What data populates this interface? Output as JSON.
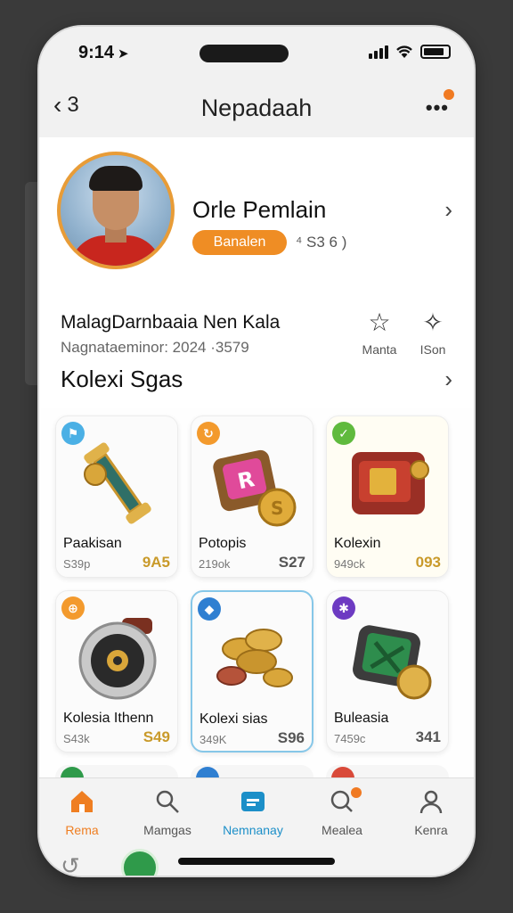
{
  "status": {
    "time": "9:14",
    "time_arrow": "➤"
  },
  "navbar": {
    "back_count": "3",
    "title": "Nepadaah",
    "more": "•••"
  },
  "profile": {
    "name": "Orle Pemlain",
    "badge": "Banalen",
    "stat": "⁴ S3 6 )",
    "guild": "MalagDarnbaaia Nen Kala",
    "meta": "Nagnataeminor: 2024 ·3579",
    "actions": [
      {
        "label": "Manta",
        "icon": "star-icon"
      },
      {
        "label": "ISon",
        "icon": "share-icon"
      }
    ]
  },
  "section": {
    "title": "Kolexi Sgas"
  },
  "cards": [
    {
      "name": "Paakisan",
      "sub": "S39p",
      "price": "9A5",
      "tag_color": "#4bb0e5",
      "tag_icon": "flag-icon",
      "tag_glyph": "⚑"
    },
    {
      "name": "Potopis",
      "sub": "219ok",
      "price": "S27",
      "tag_color": "#f39a2d",
      "tag_icon": "refresh-icon",
      "tag_glyph": "↻"
    },
    {
      "name": "Kolexin",
      "sub": "949ck",
      "price": "093",
      "tag_color": "#5fba3d",
      "tag_icon": "check-icon",
      "tag_glyph": "✓"
    },
    {
      "name": "Kolesia Ithenn",
      "sub": "S43k",
      "price": "S49",
      "tag_color": "#f39a2d",
      "tag_icon": "lock-icon",
      "tag_glyph": "⊕"
    },
    {
      "name": "Kolexi sias",
      "sub": "349K",
      "price": "S96",
      "tag_color": "#2f7fd1",
      "tag_icon": "shield-icon",
      "tag_glyph": "◆"
    },
    {
      "name": "Buleasia",
      "sub": "7459c",
      "price": "341",
      "tag_color": "#6d3bc2",
      "tag_icon": "sparkle-icon",
      "tag_glyph": "✱"
    }
  ],
  "tabs": [
    {
      "label": "Rema",
      "icon": "home-icon"
    },
    {
      "label": "Mamgas",
      "icon": "search-icon"
    },
    {
      "label": "Nemnanay",
      "icon": "wallet-icon"
    },
    {
      "label": "Mealea",
      "icon": "chat-icon"
    },
    {
      "label": "Kenra",
      "icon": "profile-icon"
    }
  ],
  "colors": {
    "accent": "#ef8d24",
    "active_tab": "#1c8fc8"
  }
}
